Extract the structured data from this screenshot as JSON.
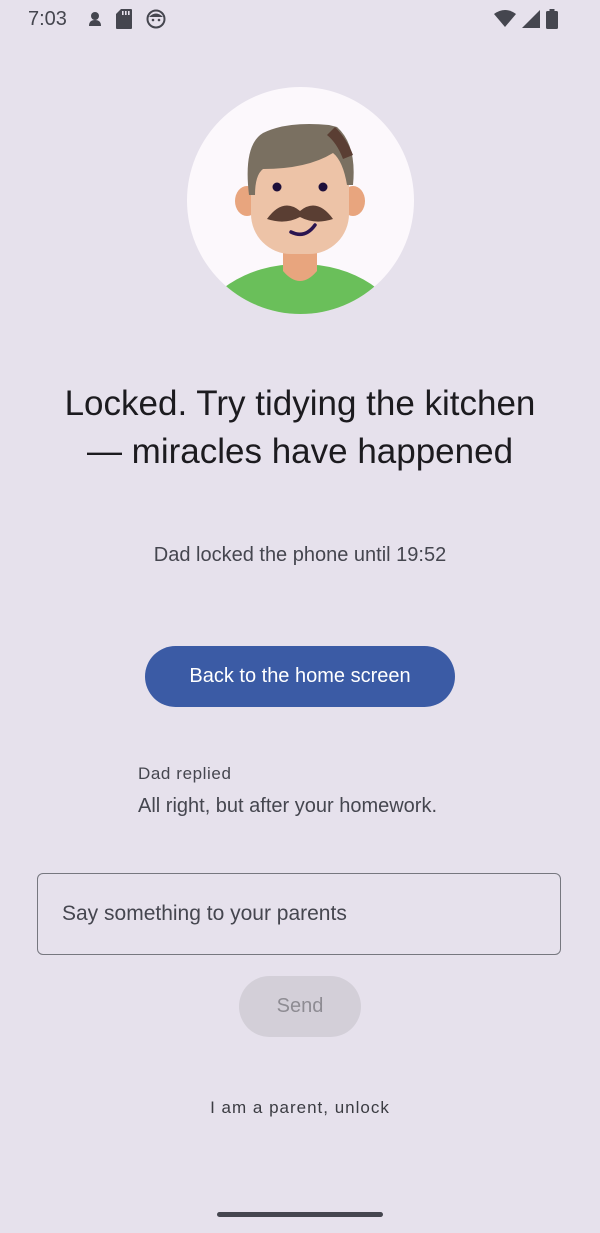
{
  "status_bar": {
    "time": "7:03",
    "left_icons": [
      "person-icon",
      "sd-card-icon",
      "face-icon"
    ],
    "right_icons": [
      "wifi-icon",
      "signal-icon",
      "battery-icon"
    ]
  },
  "avatar": {
    "icon": "dad-avatar-icon",
    "colors": {
      "background": "#FCF8FC",
      "hair": "#7A7061",
      "skin": "#EDC3A7",
      "ear": "#E8A57E",
      "shirt": "#6ABF5A",
      "mustache": "#5A3E33"
    }
  },
  "lock": {
    "title": "Locked. Try tidying the kitchen — miracles have happened",
    "subtitle": "Dad locked the phone until 19:52"
  },
  "home_button": {
    "label": "Back to the home screen"
  },
  "reply": {
    "label": "Dad replied",
    "text": "All right, but after your homework."
  },
  "message": {
    "placeholder": "Say something to your parents",
    "value": ""
  },
  "send_button": {
    "label": "Send"
  },
  "parent_unlock": {
    "label": "I am a parent, unlock"
  },
  "colors": {
    "background": "#E6E1EC",
    "primary": "#3B5BA5",
    "disabled_button": "#D3CFD8"
  }
}
